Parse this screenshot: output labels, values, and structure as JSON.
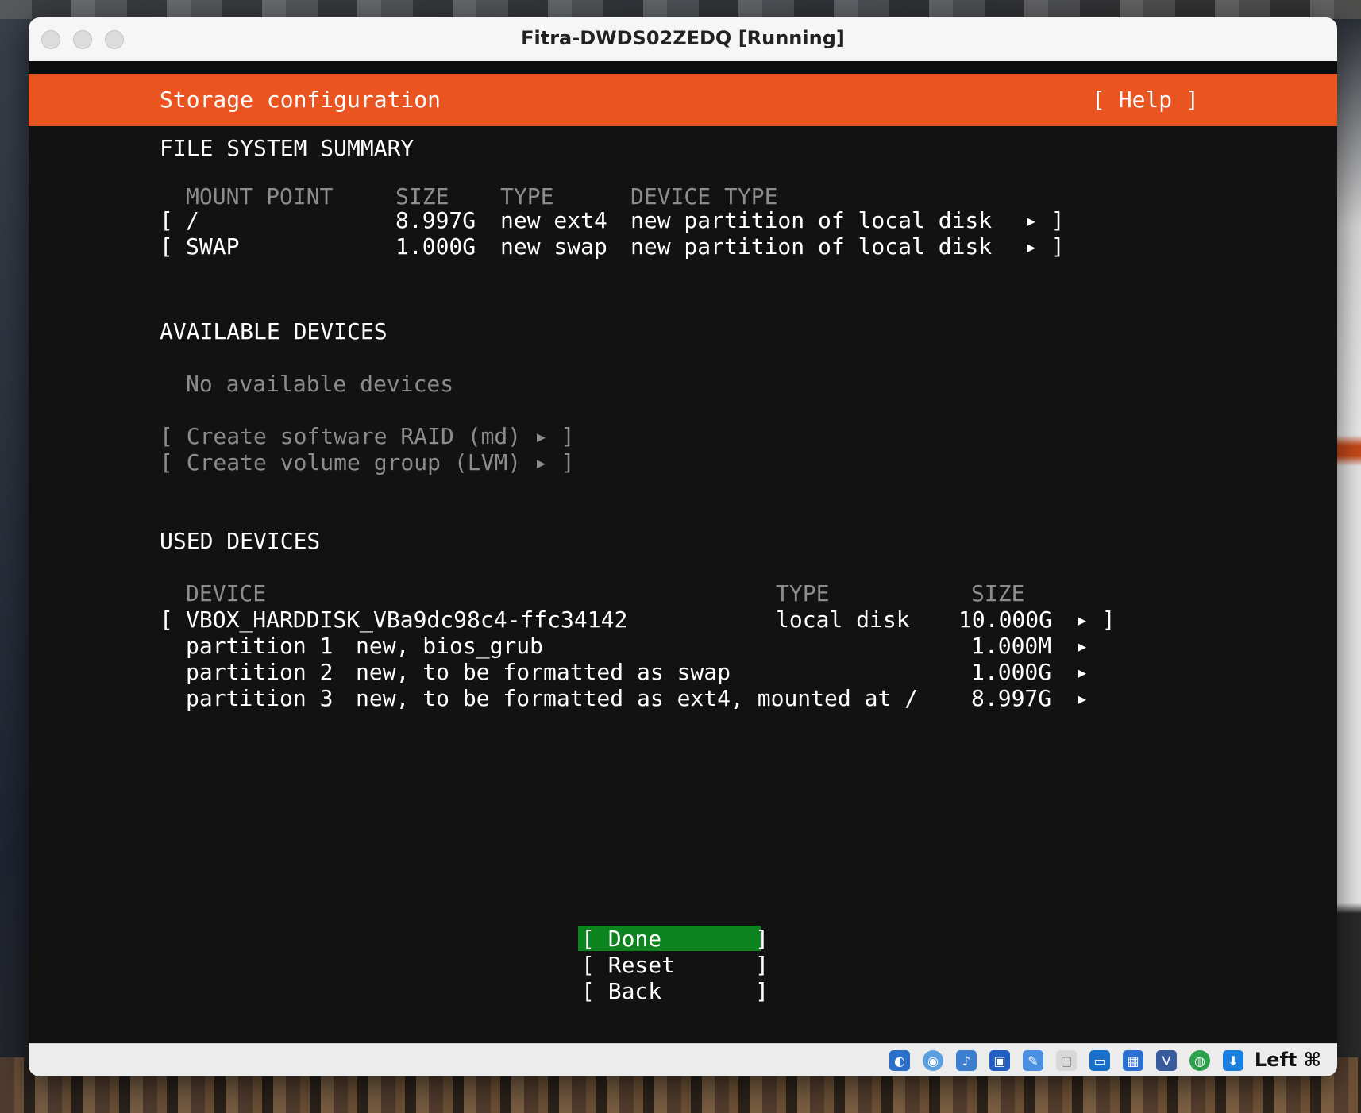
{
  "window": {
    "title": "Fitra-DWDS02ZEDQ [Running]"
  },
  "installer": {
    "header_title": "Storage configuration",
    "help_button": "[ Help ]",
    "fs_summary": {
      "heading": "FILE SYSTEM SUMMARY",
      "columns": [
        "MOUNT POINT",
        "SIZE",
        "TYPE",
        "DEVICE TYPE"
      ],
      "rows": [
        {
          "bracket": "[",
          "mount": "/",
          "size": "8.997G",
          "type": "new ext4",
          "device_type": "new partition of local disk",
          "arrow": "▸ ]"
        },
        {
          "bracket": "[",
          "mount": "SWAP",
          "size": "1.000G",
          "type": "new swap",
          "device_type": "new partition of local disk",
          "arrow": "▸ ]"
        }
      ]
    },
    "available": {
      "heading": "AVAILABLE DEVICES",
      "empty_text": "No available devices",
      "actions": [
        "[ Create software RAID (md) ▸ ]",
        "[ Create volume group (LVM) ▸ ]"
      ]
    },
    "used": {
      "heading": "USED DEVICES",
      "columns": [
        "DEVICE",
        "TYPE",
        "SIZE"
      ],
      "disk": {
        "bracket": "[",
        "name": "VBOX_HARDDISK_VBa9dc98c4-ffc34142",
        "type": "local disk",
        "size": "10.000G",
        "arrow": "▸ ]"
      },
      "partitions": [
        {
          "label": "partition 1",
          "desc": "new, bios_grub",
          "size": "1.000M",
          "arrow": "▸"
        },
        {
          "label": "partition 2",
          "desc": "new, to be formatted as swap",
          "size": "1.000G",
          "arrow": "▸"
        },
        {
          "label": "partition 3",
          "desc": "new, to be formatted as ext4, mounted at /",
          "size": "8.997G",
          "arrow": "▸"
        }
      ]
    },
    "buttons": {
      "done": "[ Done       ]",
      "reset": "[ Reset      ]",
      "back": "[ Back       ]"
    }
  },
  "statusbar": {
    "host_key": "Left ⌘",
    "icons": [
      "hard-disk-icon",
      "optical-disk-icon",
      "audio-icon",
      "network-icon",
      "usb-icon",
      "shared-folder-icon",
      "display-icon",
      "screen-capture-icon",
      "video-capture-icon",
      "globe-icon",
      "download-icon"
    ]
  },
  "colors": {
    "header_bg": "#e95420",
    "terminal_bg": "#121212",
    "done_bg": "#0e8420",
    "dim_text": "#8c8c8c"
  }
}
